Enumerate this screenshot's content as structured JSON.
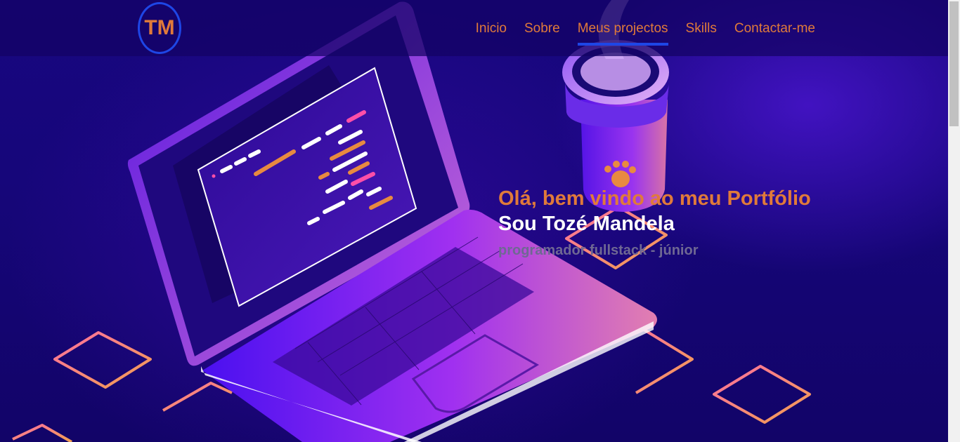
{
  "logo": {
    "text": "TM"
  },
  "nav": {
    "items": [
      {
        "label": "Inicio"
      },
      {
        "label": "Sobre"
      },
      {
        "label": "Meus projectos",
        "active": true
      },
      {
        "label": "Skills"
      },
      {
        "label": "Contactar-me"
      }
    ]
  },
  "hero": {
    "greeting": "Olá, bem vindo ao meu Portfólio",
    "name": "Sou Tozé Mandela",
    "role": "programador fullstack - júnior"
  },
  "colors": {
    "accent": "#e07a3a",
    "brand_blue": "#1e46e6",
    "background": "#16067a"
  },
  "icons": [
    "paw-icon"
  ]
}
